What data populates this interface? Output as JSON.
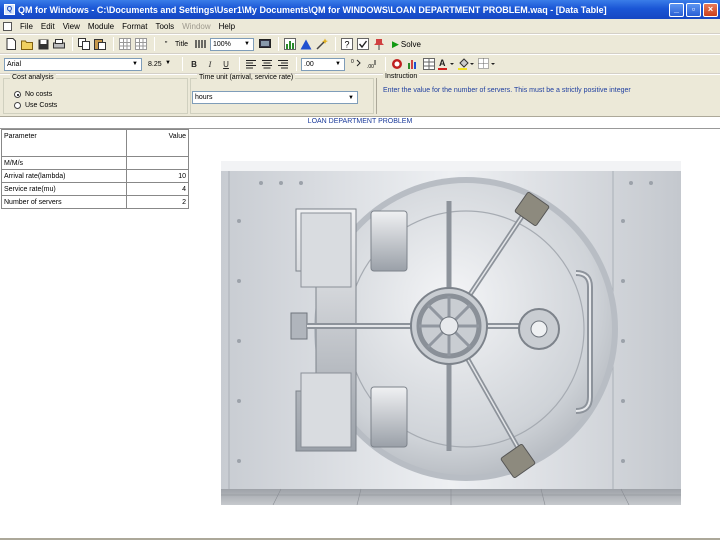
{
  "window": {
    "title": "QM for Windows - C:\\Documents and Settings\\User1\\My Documents\\QM for WINDOWS\\LOAN DEPARTMENT PROBLEM.waq - [Data Table]",
    "min_glyph": "_",
    "max_glyph": "▫",
    "close_glyph": "×"
  },
  "menu": {
    "items": [
      "File",
      "Edit",
      "View",
      "Module",
      "Format",
      "Tools",
      "Window",
      "Help"
    ],
    "disabled_index": 6
  },
  "toolbar1": {
    "title_label": "Title",
    "zoom_value": "100%",
    "solve_label": "Solve"
  },
  "toolbar2": {
    "font_value": "Arial",
    "font_size_value": "8.25",
    "bold": "B",
    "italic": "I",
    "underline": "U",
    "decimal_value": ".00"
  },
  "options": {
    "cost_analysis": {
      "title": "Cost analysis",
      "radio_no_costs": "No costs",
      "radio_use_costs": "Use Costs",
      "selected": "No costs"
    },
    "time_unit": {
      "title": "Time unit (arrival, service rate)",
      "value": "hours"
    },
    "instruction": {
      "title": "Instruction",
      "text": "Enter the value for the number of servers. This must be a strictly positive integer"
    }
  },
  "sheet": {
    "title": "LOAN DEPARTMENT PROBLEM",
    "col_parameter": "Parameter",
    "col_value": "Value",
    "rows": [
      {
        "parameter": "M/M/s",
        "value": ""
      },
      {
        "parameter": "Arrival rate(lambda)",
        "value": "10"
      },
      {
        "parameter": "Service rate(mu)",
        "value": "4"
      },
      {
        "parameter": "Number of servers",
        "value": "2"
      }
    ]
  },
  "colors": {
    "titlebar": "#1a56d6",
    "instruction_text": "#2040a0",
    "sheet_title_text": "#1a3a9a",
    "chrome": "#ece9d8"
  }
}
